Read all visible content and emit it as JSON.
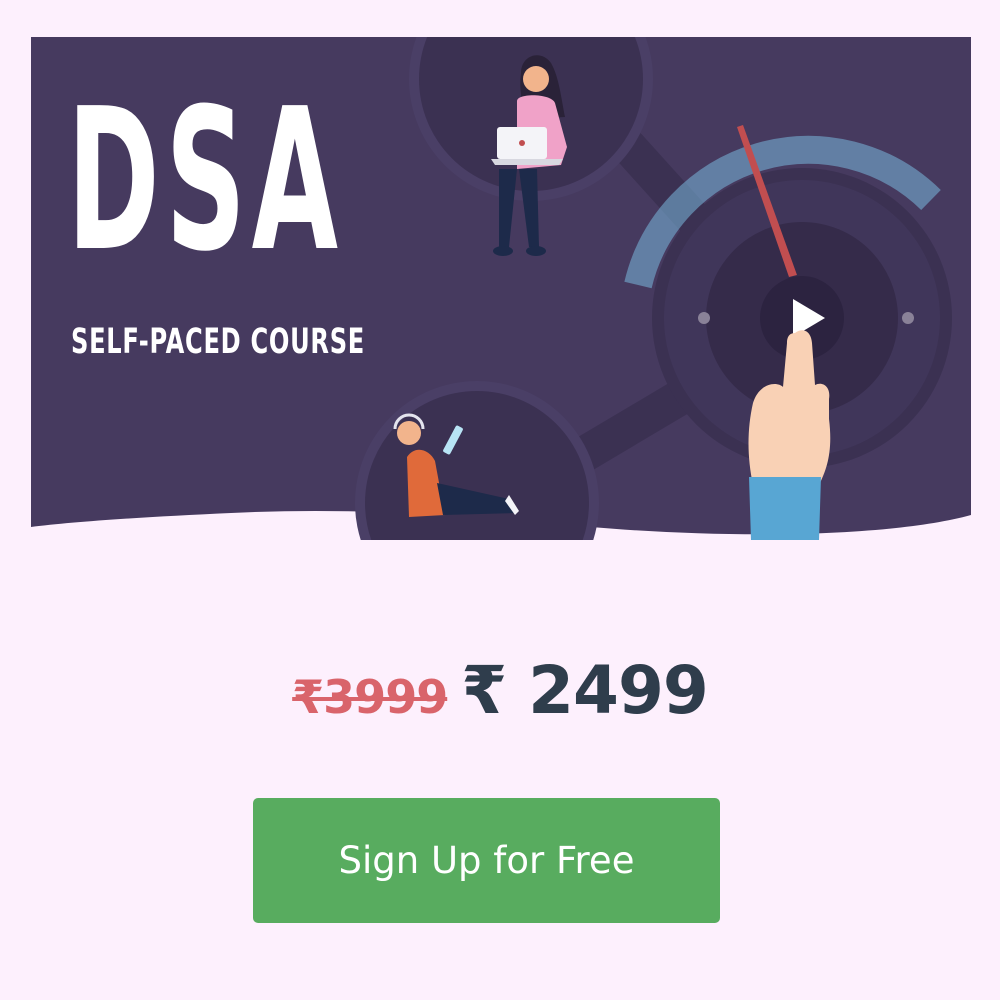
{
  "banner": {
    "title": "DSA",
    "subtitle": "SELF-PACED COURSE",
    "colors": {
      "background": "#463a5f",
      "accent_red": "#c14e50",
      "accent_blue": "#73c2e8",
      "text": "#ffffff"
    },
    "icons": [
      "person-with-laptop-illustration",
      "person-with-tablet-illustration",
      "dial-illustration",
      "play-icon",
      "hand-pointer-illustration"
    ]
  },
  "pricing": {
    "original_price": "₹3999",
    "current_price": "₹ 2499",
    "colors": {
      "original": "#d9646b",
      "current": "#2f3d4c"
    }
  },
  "cta": {
    "label": "Sign Up for Free",
    "color": "#58ac5f"
  },
  "page": {
    "background": "#fdf0fd"
  }
}
